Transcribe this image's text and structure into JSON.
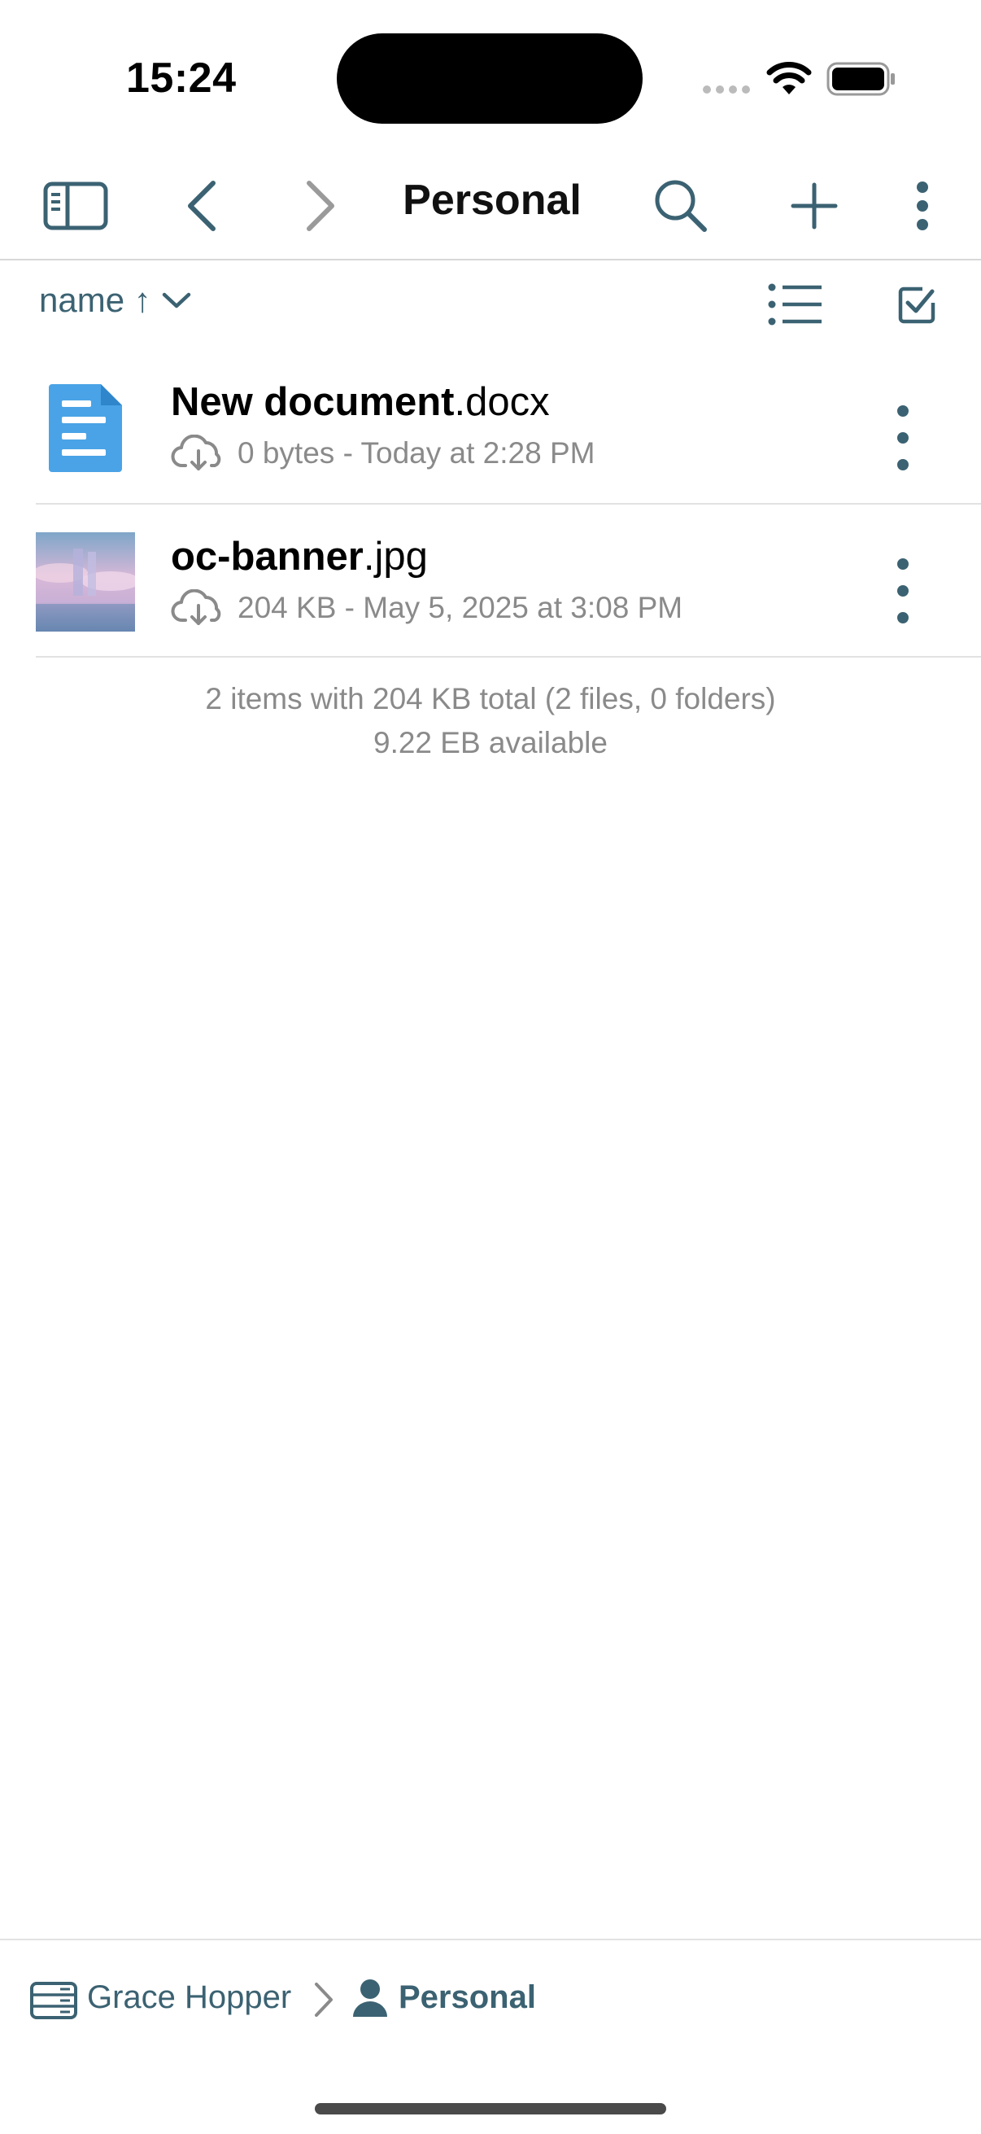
{
  "status_bar": {
    "time": "15:24"
  },
  "navbar": {
    "title": "Personal",
    "icons": {
      "sidebar": "sidebar-icon",
      "back": "chevron-left-icon",
      "forward": "chevron-right-icon",
      "search": "search-icon",
      "add": "plus-icon",
      "more": "more-vertical-icon"
    }
  },
  "sort": {
    "label": "name ↑"
  },
  "files": [
    {
      "name": "New document",
      "ext": ".docx",
      "meta": "0 bytes - Today at 2:28 PM",
      "icon": "document-icon"
    },
    {
      "name": "oc-banner",
      "ext": ".jpg",
      "meta": "204 KB - May 5, 2025 at 3:08 PM",
      "icon": "image-thumbnail"
    }
  ],
  "summary": {
    "line1": "2 items with 204 KB total (2 files, 0 folders)",
    "line2": "9.22 EB available"
  },
  "path": {
    "root": "Grace Hopper",
    "current": "Personal"
  },
  "colors": {
    "accent": "#3b6272",
    "doc_icon": "#4aa3e6",
    "secondary_text": "#8a8a8a"
  }
}
